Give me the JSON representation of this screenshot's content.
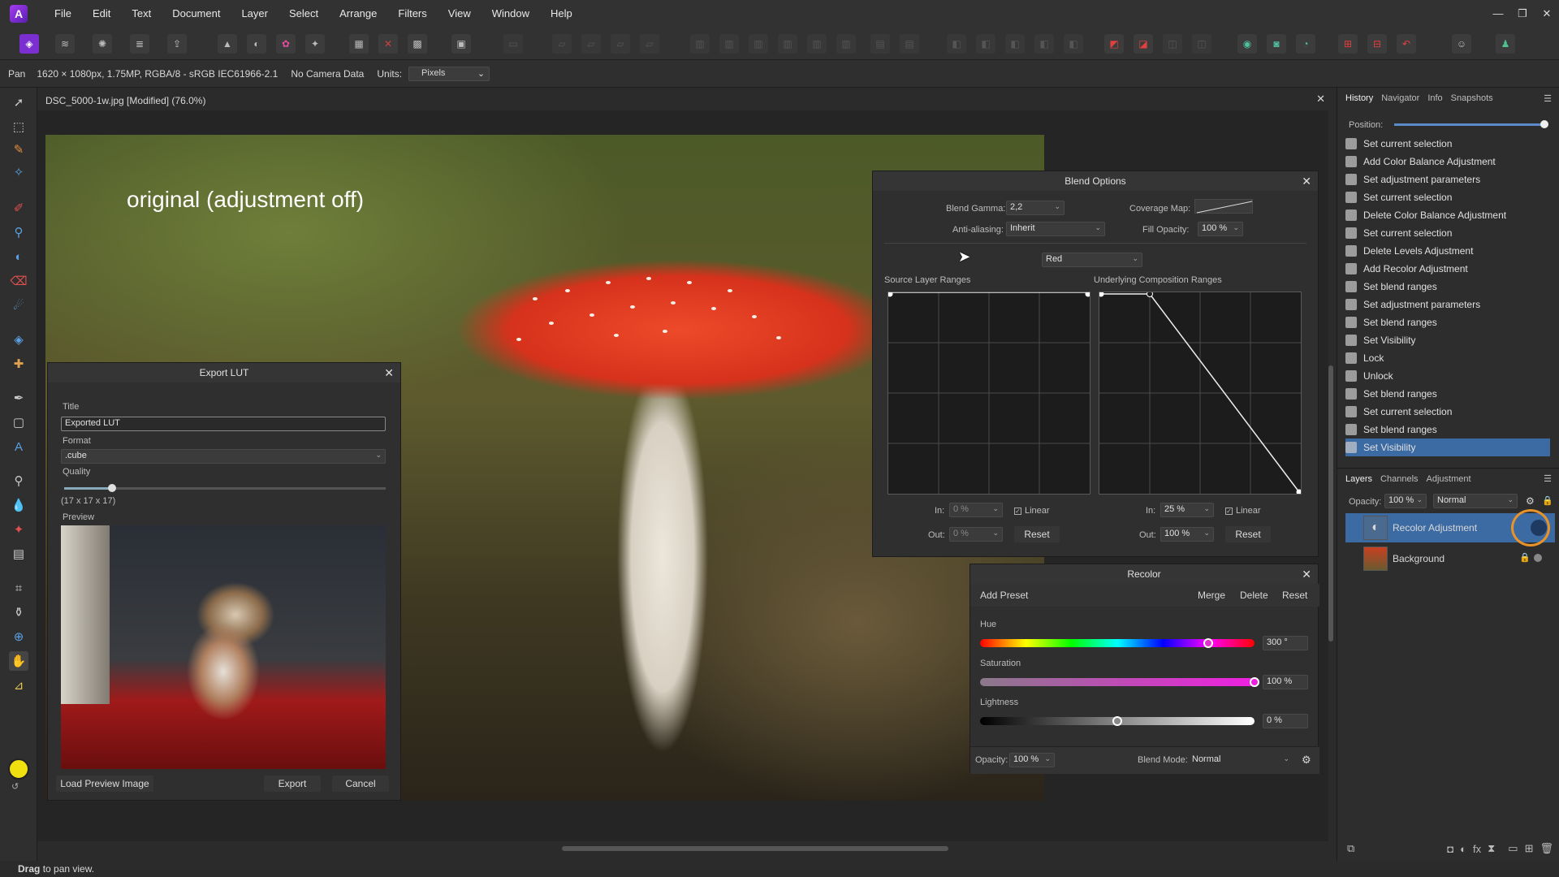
{
  "menu": {
    "items": [
      "File",
      "Edit",
      "Text",
      "Document",
      "Layer",
      "Select",
      "Arrange",
      "Filters",
      "View",
      "Window",
      "Help"
    ]
  },
  "context_bar": {
    "tool": "Pan",
    "image_info": "1620 × 1080px, 1.75MP, RGBA/8 - sRGB IEC61966-2.1",
    "camera": "No Camera Data",
    "units_label": "Units:",
    "units_value": "Pixels"
  },
  "document": {
    "tab_title": "DSC_5000-1w.jpg [Modified] (76.0%)",
    "caption": "original (adjustment off)"
  },
  "export_lut": {
    "title": "Export LUT",
    "title_label": "Title",
    "title_value": "Exported LUT",
    "format_label": "Format",
    "format_value": ".cube",
    "quality_label": "Quality",
    "quality_value": 0.15,
    "quality_dims": "(17 x 17 x 17)",
    "preview_label": "Preview",
    "load_button": "Load Preview Image",
    "export_button": "Export",
    "cancel_button": "Cancel"
  },
  "blend_options": {
    "title": "Blend Options",
    "gamma_label": "Blend Gamma:",
    "gamma_value": "2,2",
    "coverage_label": "Coverage Map:",
    "aa_label": "Anti-aliasing:",
    "aa_value": "Inherit",
    "fill_label": "Fill Opacity:",
    "fill_value": "100 %",
    "channel_value": "Red",
    "source_label": "Source Layer Ranges",
    "underlying_label": "Underlying Composition Ranges",
    "in_label": "In:",
    "out_label": "Out:",
    "src_in": "0 %",
    "src_out": "0 %",
    "und_in": "25 %",
    "und_out": "100 %",
    "linear_label": "Linear",
    "reset_label": "Reset"
  },
  "recolor": {
    "title": "Recolor",
    "add_preset": "Add Preset",
    "merge": "Merge",
    "delete": "Delete",
    "reset": "Reset",
    "hue_label": "Hue",
    "hue_value": "300 °",
    "hue_fraction": 0.83,
    "sat_label": "Saturation",
    "sat_value": "100 %",
    "sat_fraction": 1.0,
    "light_label": "Lightness",
    "light_value": "0 %",
    "light_fraction": 0.5,
    "opacity_label": "Opacity:",
    "opacity_value": "100 %",
    "blend_label": "Blend Mode:",
    "blend_value": "Normal"
  },
  "history_panel": {
    "tabs": [
      "History",
      "Navigator",
      "Info",
      "Snapshots"
    ],
    "position_label": "Position:",
    "items": [
      "Set current selection",
      "Add Color Balance Adjustment",
      "Set adjustment parameters",
      "Set current selection",
      "Delete Color Balance Adjustment",
      "Set current selection",
      "Delete Levels Adjustment",
      "Add Recolor Adjustment",
      "Set blend ranges",
      "Set adjustment parameters",
      "Set blend ranges",
      "Set Visibility",
      "Lock",
      "Unlock",
      "Set blend ranges",
      "Set current selection",
      "Set blend ranges",
      "Set Visibility"
    ]
  },
  "layers_panel": {
    "tabs": [
      "Layers",
      "Channels",
      "Adjustment"
    ],
    "opacity_label": "Opacity:",
    "opacity_value": "100 %",
    "blend_value": "Normal",
    "layers": [
      "Recolor Adjustment",
      "Background"
    ]
  },
  "status": {
    "bold": "Drag",
    "text": "to pan view."
  },
  "colors": {
    "accent": "#3c6aa3",
    "highlight_ring": "#e8932a",
    "app_logo": "#8f2fe0"
  }
}
